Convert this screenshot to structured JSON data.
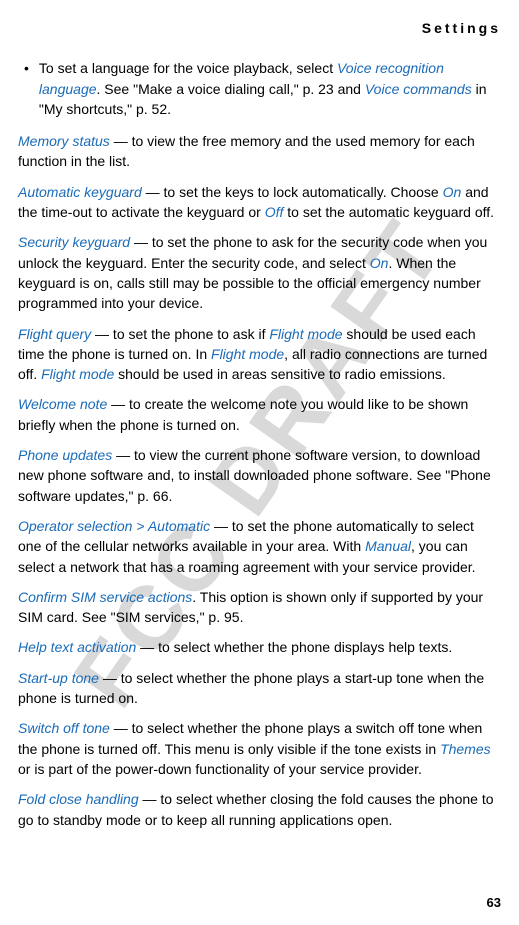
{
  "header": {
    "title": "Settings"
  },
  "watermark": "FCC DRAFT",
  "bullet": {
    "text_1": "To set a language for the voice playback, select ",
    "voice_recognition_language": "Voice recognition language",
    "text_2": ". See \"Make a voice dialing call,\" p. 23 and ",
    "voice_commands": "Voice commands",
    "text_3": " in \"My shortcuts,\" p. 52."
  },
  "memory_status": {
    "term": "Memory status",
    "text": " — to view the free memory and the used memory for each function in the list."
  },
  "automatic_keyguard": {
    "term": "Automatic keyguard",
    "text_1": " — to set the keys to lock automatically. Choose ",
    "on": "On",
    "text_2": " and the time-out to activate the keyguard or ",
    "off": "Off",
    "text_3": " to set the automatic keyguard off."
  },
  "security_keyguard": {
    "term": "Security keyguard",
    "text_1": " — to set the phone to ask for the security code when you unlock the keyguard. Enter the security code, and select ",
    "on": "On",
    "text_2": ". When the keyguard is on, calls still may be possible to the official emergency number programmed into your device."
  },
  "flight_query": {
    "term": "Flight query",
    "text_1": " — to set the phone to ask if ",
    "flight_mode_1": "Flight mode",
    "text_2": " should be used each time the phone is turned on. In ",
    "flight_mode_2": "Flight mode",
    "text_3": ", all radio connections are turned off. ",
    "flight_mode_3": "Flight mode",
    "text_4": " should be used in areas sensitive to radio emissions."
  },
  "welcome_note": {
    "term": "Welcome note",
    "text": " — to create the welcome note you would like to be shown briefly when the phone is turned on."
  },
  "phone_updates": {
    "term": "Phone updates",
    "text": " — to view the current phone software version, to download new phone software and, to install downloaded phone software. See \"Phone software updates,\" p. 66."
  },
  "operator_selection": {
    "term": "Operator selection",
    "gt": " > ",
    "automatic": "Automatic",
    "text_1": " — to set the phone automatically to select one of the cellular networks available in your area. With ",
    "manual": "Manual",
    "text_2": ", you can select a network that has a roaming agreement with your service provider."
  },
  "confirm_sim": {
    "term": "Confirm SIM service actions",
    "text": ". This option is shown only if supported by your SIM card. See \"SIM services,\" p. 95."
  },
  "help_text": {
    "term": "Help text activation",
    "text": " — to select whether the phone displays help texts."
  },
  "start_up_tone": {
    "term": "Start-up tone",
    "text": " — to select whether the phone plays a start-up tone when the phone is turned on."
  },
  "switch_off_tone": {
    "term": "Switch off tone",
    "text_1": " — to select whether the phone plays a switch off tone when the phone is turned off. This menu is only visible if the tone exists in ",
    "themes": "Themes",
    "text_2": " or is part of the power-down functionality of your service provider."
  },
  "fold_close": {
    "term": "Fold close handling",
    "text": " — to select whether closing the fold causes the phone to go to standby mode or to keep all running applications open."
  },
  "page_number": "63"
}
